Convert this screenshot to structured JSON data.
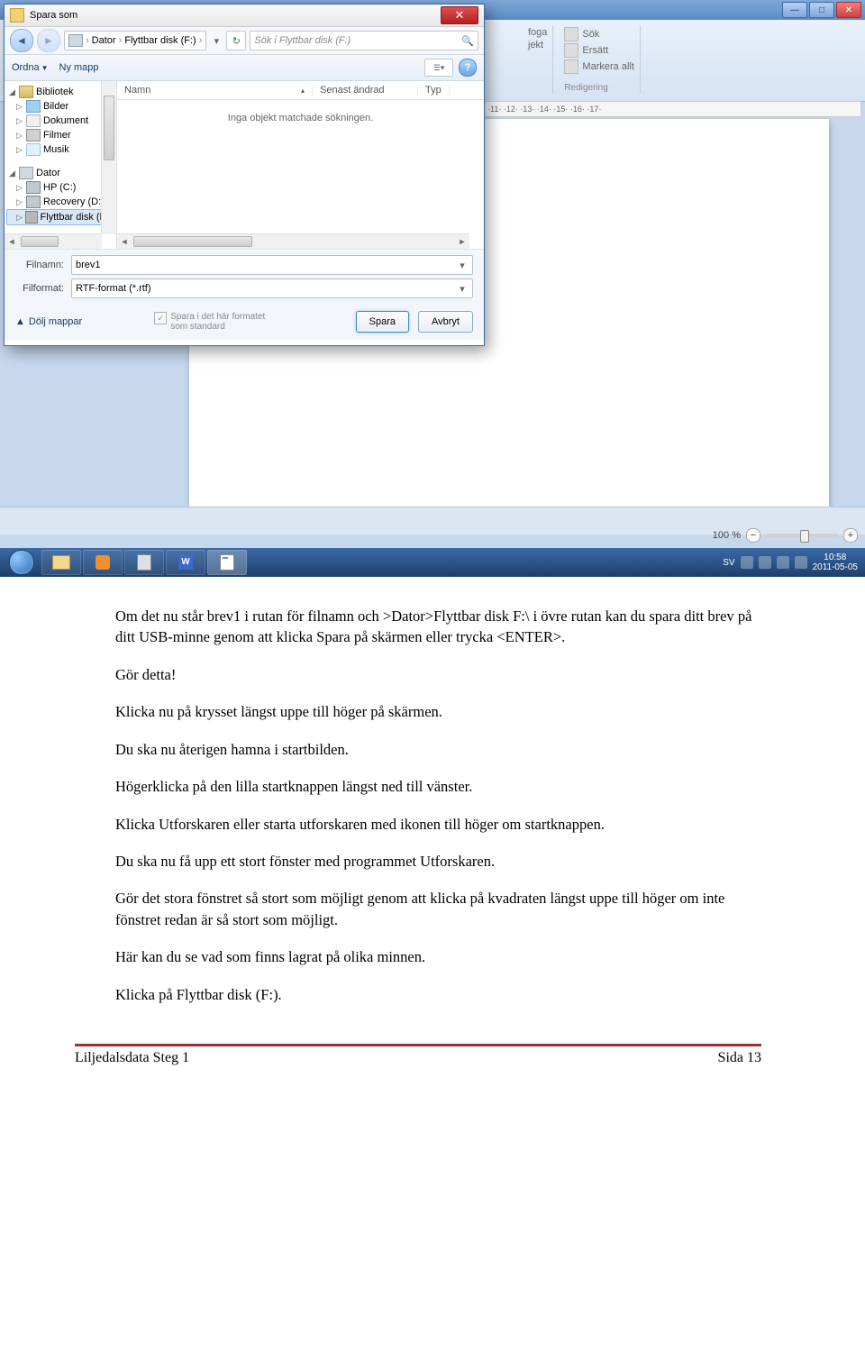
{
  "bgapp": {
    "ribbon": {
      "items": [
        "Sök",
        "Ersätt",
        "Markera allt",
        "foga",
        "jekt"
      ],
      "group_label": "Redigering"
    },
    "ruler": "·11· ·12· ·13· ·14· ·15· ·16· ·17·",
    "zoom": {
      "pct": "100 %",
      "minus": "−",
      "plus": "+"
    }
  },
  "taskbar": {
    "lang": "SV",
    "time": "10:58",
    "date": "2011-05-05"
  },
  "dialog": {
    "title": "Spara som",
    "breadcrumb": {
      "seg1": "Dator",
      "seg2": "Flyttbar disk (F:)"
    },
    "search_placeholder": "Sök i Flyttbar disk (F:)",
    "toolbar": {
      "organize": "Ordna",
      "new_folder": "Ny mapp"
    },
    "tree": {
      "lib": "Bibliotek",
      "pic": "Bilder",
      "doc": "Dokument",
      "film": "Filmer",
      "music": "Musik",
      "pc": "Dator",
      "hdd_c": "HP (C:)",
      "hdd_d": "Recovery (D:)",
      "usb_f": "Flyttbar disk (F:)"
    },
    "columns": {
      "name": "Namn",
      "date": "Senast ändrad",
      "type": "Typ"
    },
    "empty": "Inga objekt matchade sökningen.",
    "filename_label": "Filnamn:",
    "filename_value": "brev1",
    "format_label": "Filformat:",
    "format_value": "RTF-format (*.rtf)",
    "hide_folders": "Dölj mappar",
    "default_format": "Spara i det här formatet som standard",
    "save": "Spara",
    "cancel": "Avbryt"
  },
  "doc": {
    "p1": "Om det nu står brev1 i rutan för filnamn och >Dator>Flyttbar disk F:\\ i övre rutan kan du spara ditt brev på ditt USB-minne genom att klicka Spara på skärmen eller trycka <ENTER>.",
    "p2": "Gör detta!",
    "p3": "Klicka nu på krysset längst uppe till höger på skärmen.",
    "p4": "Du ska nu återigen hamna i startbilden.",
    "p5": "Högerklicka på den lilla startknappen längst ned till vänster.",
    "p6": "Klicka Utforskaren eller starta utforskaren med ikonen till höger om startknappen.",
    "p7": "Du ska nu få upp ett stort fönster med programmet Utforskaren.",
    "p8": "Gör det stora fönstret så stort som möjligt genom att klicka på kvadraten längst uppe till höger om inte fönstret redan är så stort som möjligt.",
    "p9": "Här kan du se vad som finns lagrat på olika minnen.",
    "p10": "Klicka på Flyttbar disk (F:)."
  },
  "footer": {
    "left": "Liljedalsdata Steg 1",
    "right": "Sida 13"
  }
}
